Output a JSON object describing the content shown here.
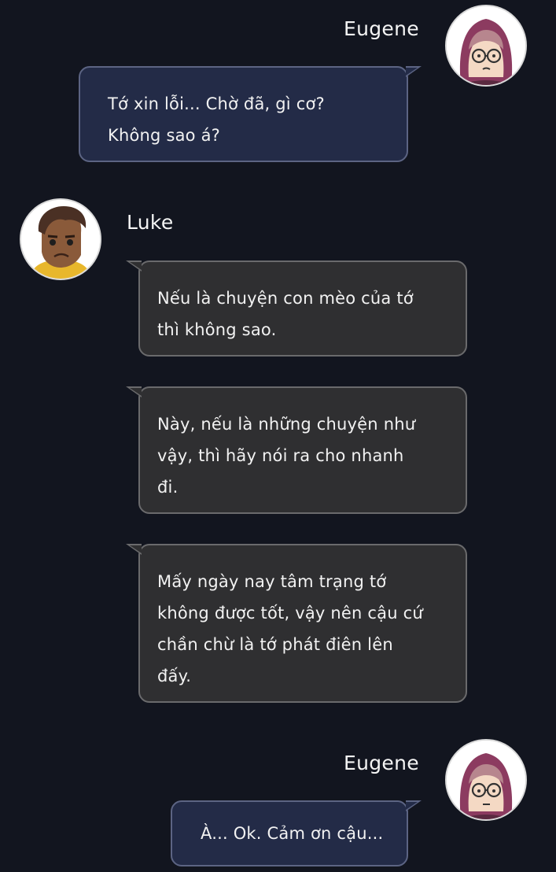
{
  "conversation": [
    {
      "sender": "Eugene",
      "side": "right",
      "avatar_icon": "eugene-avatar-icon",
      "bubbles": [
        {
          "lines": [
            "Tớ xin lỗi... Chờ đã, gì cơ?",
            "Không sao á?"
          ]
        }
      ]
    },
    {
      "sender": "Luke",
      "side": "left",
      "avatar_icon": "luke-avatar-icon",
      "bubbles": [
        {
          "lines": [
            "Nếu là chuyện con mèo của tớ",
            "thì không sao."
          ]
        },
        {
          "lines": [
            "Này, nếu là những chuyện như",
            "vậy, thì hãy nói ra cho nhanh",
            "đi."
          ]
        },
        {
          "lines": [
            "Mấy ngày nay tâm trạng tớ",
            "không được tốt, vậy nên cậu cứ",
            "chần chừ là tớ phát điên lên",
            "đấy."
          ]
        }
      ]
    },
    {
      "sender": "Eugene",
      "side": "right",
      "avatar_icon": "eugene-avatar-icon",
      "bubbles": [
        {
          "lines": [
            "À... Ok. Cảm ơn cậu..."
          ]
        }
      ]
    }
  ],
  "colors": {
    "background": "#12151f",
    "eugene_bubble": "#232b47",
    "luke_bubble": "#2f2f31",
    "text": "#f2f2f2"
  }
}
